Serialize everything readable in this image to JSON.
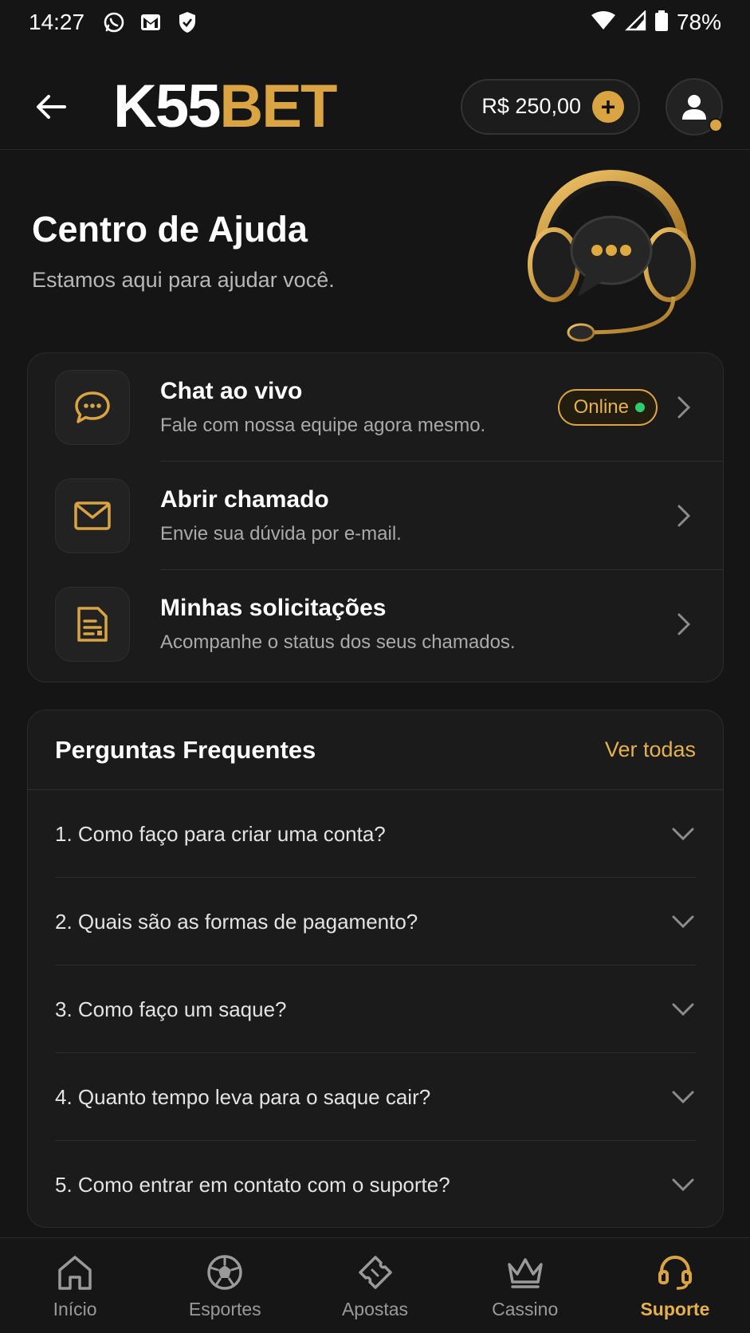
{
  "status_bar": {
    "time": "14:27",
    "icons": [
      "whatsapp-icon",
      "gmail-icon",
      "shield-icon"
    ],
    "battery": "78%"
  },
  "header": {
    "logo_part1": "K55",
    "logo_part2": "BET",
    "balance": "R$ 250,00",
    "plus_label": "+"
  },
  "hero": {
    "title": "Centro de Ajuda",
    "subtitle": "Estamos aqui para ajudar você."
  },
  "support": {
    "items": [
      {
        "icon": "chat-bubble-icon",
        "title": "Chat ao vivo",
        "desc": "Fale com nossa equipe agora mesmo.",
        "badge": "Online"
      },
      {
        "icon": "mail-icon",
        "title": "Abrir chamado",
        "desc": "Envie sua dúvida por e-mail."
      },
      {
        "icon": "document-icon",
        "title": "Minhas solicitações",
        "desc": "Acompanhe o status dos seus chamados."
      }
    ]
  },
  "faq": {
    "title": "Perguntas Frequentes",
    "see_all": "Ver todas",
    "items": [
      "1. Como faço para criar uma conta?",
      "2. Quais são as formas de pagamento?",
      "3. Como faço um saque?",
      "4. Quanto tempo leva para o saque cair?",
      "5. Como entrar em contato com o suporte?"
    ]
  },
  "nav": {
    "items": [
      {
        "label": "Início",
        "icon": "home-icon"
      },
      {
        "label": "Esportes",
        "icon": "soccer-ball-icon"
      },
      {
        "label": "Apostas",
        "icon": "ticket-icon"
      },
      {
        "label": "Cassino",
        "icon": "crown-icon"
      },
      {
        "label": "Suporte",
        "icon": "headset-icon",
        "active": true
      }
    ]
  },
  "colors": {
    "accent": "#d9a441",
    "background": "#151515",
    "card": "#1b1b1b",
    "online": "#2ecc71"
  }
}
